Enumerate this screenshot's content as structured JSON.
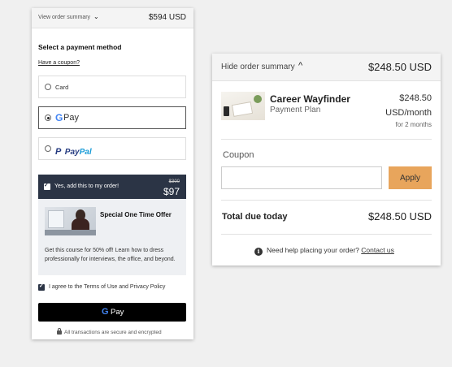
{
  "left_panel": {
    "summary_toggle": "View order summary",
    "summary_chevron": "⌄",
    "summary_price": "$594 USD",
    "title": "Select a payment method",
    "coupon_link": "Have a coupon?",
    "payment_methods": [
      {
        "label": "Card",
        "selected": false
      },
      {
        "label": "Pay",
        "selected": true
      },
      {
        "label_p": "P",
        "label_pay": "Pay",
        "label_pal": "Pal",
        "selected": false
      }
    ],
    "upsell": {
      "checkbox_label": "Yes, add this to my order!",
      "old_price": "$300",
      "new_price": "$97",
      "offer_title": "Special One Time Offer",
      "description": "Get this course for 50% off! Learn how to dress professionally for interviews, the office, and beyond."
    },
    "terms": "I agree to the Terms of Use and Privacy Policy",
    "gpay_button": {
      "g": "G",
      "label": "Pay"
    },
    "secure_note": "All transactions are secure and encrypted"
  },
  "right_panel": {
    "summary_toggle": "Hide order summary",
    "summary_chevron": "^",
    "summary_price": "$248.50 USD",
    "product": {
      "name": "Career Wayfinder",
      "plan": "Payment Plan",
      "price_line1": "$248.50",
      "price_line2": "USD/month",
      "price_line3": "for 2 months"
    },
    "coupon_label": "Coupon",
    "coupon_value": "",
    "apply_label": "Apply",
    "total_label": "Total due today",
    "total_value": "$248.50 USD",
    "help_text": "Need help placing your order?",
    "contact_link": "Contact us",
    "info_glyph": "i"
  },
  "colors": {
    "accent_dark": "#2b3445",
    "apply_orange": "#e8a55c",
    "paypal_dark": "#253b80",
    "paypal_light": "#179bd7"
  }
}
